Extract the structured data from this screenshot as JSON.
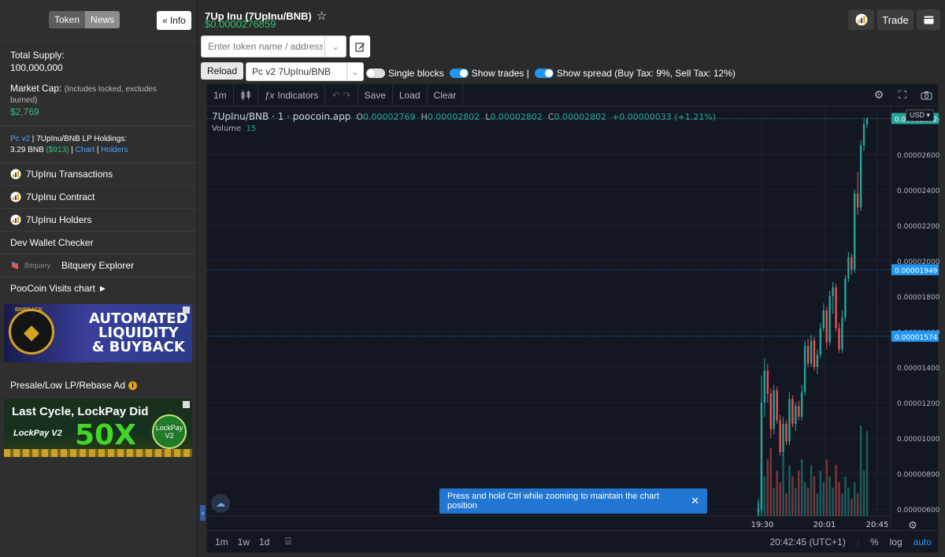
{
  "sidebar": {
    "tabs": {
      "token": "Token",
      "news": "News"
    },
    "info_button": "Info",
    "total_supply_label": "Total Supply:",
    "total_supply_value": "100,000,000",
    "market_cap_label": "Market Cap:",
    "market_cap_note": "(Includes locked, excludes burned)",
    "market_cap_value": "$2,769",
    "lp": {
      "pc": "Pc v2",
      "sep": " | ",
      "label": "7UpInu/BNB LP Holdings:",
      "amount": "3.29 BNB",
      "usd": "($913)",
      "bar1": " | ",
      "chart_link": "Chart",
      "bar2": " | ",
      "holders_link": "Holders"
    },
    "items": [
      {
        "label": "7UpInu Transactions"
      },
      {
        "label": "7UpInu Contract"
      },
      {
        "label": "7UpInu Holders"
      },
      {
        "label": "Dev Wallet Checker"
      },
      {
        "label": "Bitquery Explorer",
        "prefix": "Bitquery"
      },
      {
        "label": "PooCoin Visits chart"
      }
    ],
    "ad1": {
      "brand": "BNBBACK",
      "line1": "AUTOMATED",
      "line2": "LIQUIDITY",
      "line3": "& BUYBACK"
    },
    "presale_label": "Presale/Low LP/Rebase Ad",
    "ad2": {
      "headline": "Last Cycle, LockPay Did",
      "brand": "LockPay V2",
      "big": "50X",
      "coin": "LockPay V2"
    }
  },
  "header": {
    "title": "7Up Inu (7UpInu/BNB)",
    "price": "$0.0000276859",
    "trade_button": "Trade",
    "search_placeholder": "Enter token name / address...",
    "reload_button": "Reload",
    "pair_select": "Pc v2 7UpInu/BNB",
    "single_blocks": "Single blocks",
    "show_trades": "Show trades |",
    "show_spread": "Show spread (Buy Tax: 9%, Sell Tax: 12%)"
  },
  "chart_toolbar": {
    "interval": "1m",
    "indicators": "Indicators",
    "save": "Save",
    "load": "Load",
    "clear": "Clear"
  },
  "legend": {
    "symbol": "7UpInu/BNB · 1 · poocoin.app",
    "o_label": "O",
    "o": "0.00002769",
    "h_label": "H",
    "h": "0.00002802",
    "l_label": "L",
    "l": "0.00002802",
    "c_label": "C",
    "c": "0.00002802",
    "change": "+0.00000033 (+1.21%)",
    "volume_label": "Volume",
    "volume": "15"
  },
  "currency": "USD",
  "toast": "Press and hold Ctrl while zooming to maintain the chart position",
  "bottom": {
    "ranges": [
      "1m",
      "1w",
      "1d"
    ],
    "time": "20:42:45 (UTC+1)",
    "pct": "%",
    "log": "log",
    "auto": "auto"
  },
  "chart_data": {
    "type": "candlestick",
    "y_ticks": [
      "0.00002800",
      "0.00002600",
      "0.00002400",
      "0.00002200",
      "0.00002000",
      "0.00001800",
      "0.00001600",
      "0.00001400",
      "0.00001200",
      "0.00001000",
      "0.00000800",
      "0.00000600"
    ],
    "x_ticks": [
      "19:30",
      "20:01",
      "20:45"
    ],
    "price_labels": [
      {
        "value": 2.802e-05,
        "text": "0.00002802",
        "color": "#26a69a"
      },
      {
        "value": 1.949e-05,
        "text": "0.00001949",
        "color": "#2196f3"
      },
      {
        "value": 1.574e-05,
        "text": "0.00001574",
        "color": "#2196f3"
      }
    ],
    "ylim": [
      5.6e-06,
      2.875e-05
    ],
    "candles": [
      [
        5.8e-06,
        6.4e-06,
        5.6e-06,
        6e-06
      ],
      [
        6e-06,
        1.35e-05,
        5.8e-06,
        1.2e-05
      ],
      [
        1.2e-05,
        1.45e-05,
        1.12e-05,
        1.38e-05
      ],
      [
        1.38e-05,
        1.42e-05,
        1.2e-05,
        1.25e-05
      ],
      [
        1.25e-05,
        1.28e-05,
        1e-05,
        1.05e-05
      ],
      [
        1.05e-05,
        1.3e-05,
        1.02e-05,
        1.27e-05
      ],
      [
        1.27e-05,
        1.29e-05,
        1.08e-05,
        1.1e-05
      ],
      [
        1.1e-05,
        1.13e-05,
        9e-06,
        9.2e-06
      ],
      [
        9.2e-06,
        1.12e-05,
        9e-06,
        1.08e-05
      ],
      [
        1.08e-05,
        1.1e-05,
        9.6e-06,
        9.8e-06
      ],
      [
        9.8e-06,
        1.26e-05,
        9.6e-06,
        1.22e-05
      ],
      [
        1.22e-05,
        1.24e-05,
        1.06e-05,
        1.08e-05
      ],
      [
        1.08e-05,
        1.2e-05,
        1.04e-05,
        1.18e-05
      ],
      [
        1.18e-05,
        1.21e-05,
        1.1e-05,
        1.12e-05
      ],
      [
        1.12e-05,
        1.3e-05,
        1.1e-05,
        1.26e-05
      ],
      [
        1.26e-05,
        1.55e-05,
        1.24e-05,
        1.52e-05
      ],
      [
        1.52e-05,
        1.56e-05,
        1.4e-05,
        1.42e-05
      ],
      [
        1.42e-05,
        1.58e-05,
        1.4e-05,
        1.55e-05
      ],
      [
        1.55e-05,
        1.57e-05,
        1.38e-05,
        1.4e-05
      ],
      [
        1.4e-05,
        1.5e-05,
        1.36e-05,
        1.47e-05
      ],
      [
        1.47e-05,
        1.65e-05,
        1.45e-05,
        1.62e-05
      ],
      [
        1.62e-05,
        1.76e-05,
        1.6e-05,
        1.72e-05
      ],
      [
        1.72e-05,
        1.74e-05,
        1.5e-05,
        1.54e-05
      ],
      [
        1.54e-05,
        1.83e-05,
        1.52e-05,
        1.8e-05
      ],
      [
        1.8e-05,
        1.88e-05,
        1.7e-05,
        1.85e-05
      ],
      [
        1.85e-05,
        1.87e-05,
        1.6e-05,
        1.62e-05
      ],
      [
        1.62e-05,
        1.65e-05,
        1.48e-05,
        1.5e-05
      ],
      [
        1.5e-05,
        1.72e-05,
        1.48e-05,
        1.68e-05
      ],
      [
        1.68e-05,
        1.92e-05,
        1.66e-05,
        1.9e-05
      ],
      [
        1.9e-05,
        2.05e-05,
        1.88e-05,
        2.02e-05
      ],
      [
        2.02e-05,
        2.04e-05,
        1.92e-05,
        1.95e-05
      ],
      [
        1.95e-05,
        2.4e-05,
        1.93e-05,
        2.38e-05
      ],
      [
        2.38e-05,
        2.5e-05,
        2.26e-05,
        2.3e-05
      ],
      [
        2.3e-05,
        2.68e-05,
        2.28e-05,
        2.65e-05
      ],
      [
        2.65e-05,
        2.8e-05,
        2.62e-05,
        2.77e-05
      ],
      [
        2.77e-05,
        2.81e-05,
        2.75e-05,
        2.8e-05
      ]
    ],
    "volumes": [
      3,
      9,
      7,
      10,
      12,
      5,
      8,
      6,
      11,
      4,
      9,
      7,
      5,
      8,
      10,
      6,
      5,
      9,
      7,
      4,
      8,
      6,
      10,
      7,
      5,
      9,
      6,
      4,
      7,
      5,
      3,
      6,
      4,
      16,
      8,
      15
    ]
  }
}
